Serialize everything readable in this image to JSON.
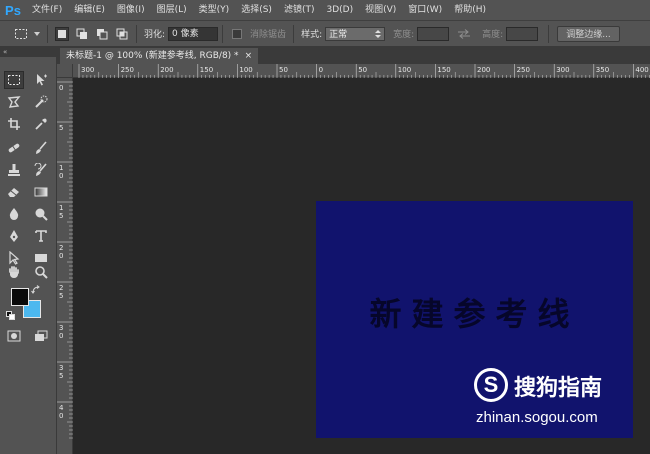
{
  "app": {
    "logo": "Ps"
  },
  "menu": [
    "文件(F)",
    "编辑(E)",
    "图像(I)",
    "图层(L)",
    "类型(Y)",
    "选择(S)",
    "滤镜(T)",
    "3D(D)",
    "视图(V)",
    "窗口(W)",
    "帮助(H)"
  ],
  "options": {
    "feather_label": "羽化:",
    "feather_value": "0 像素",
    "antialias_label": "消除锯齿",
    "style_label": "样式:",
    "style_value": "正常",
    "width_label": "宽度:",
    "height_label": "高度:",
    "refine_edge_label": "调整边缘..."
  },
  "toolbox": {
    "collapse_glyph": "«"
  },
  "document": {
    "tab_title": "未标题-1 @ 100% (新建参考线, RGB/8) *",
    "close_glyph": "×",
    "canvas_color": "#11136d",
    "canvas_text": "新建参考线"
  },
  "ruler": {
    "horizontal_labels": [
      "300",
      "250",
      "200",
      "150",
      "100",
      "50",
      "0",
      "50",
      "100",
      "150",
      "200",
      "250",
      "300",
      "350",
      "400"
    ],
    "vertical_labels": [
      "0",
      "5",
      "1 0",
      "1 5",
      "2 0",
      "2 5",
      "3 0",
      "3 5",
      "4 0"
    ]
  },
  "colors": {
    "foreground": "#0b0b0b",
    "background": "#4cb8ef"
  },
  "watermark": {
    "logo_letter": "S",
    "title": "搜狗指南",
    "url": "zhinan.sogou.com"
  }
}
